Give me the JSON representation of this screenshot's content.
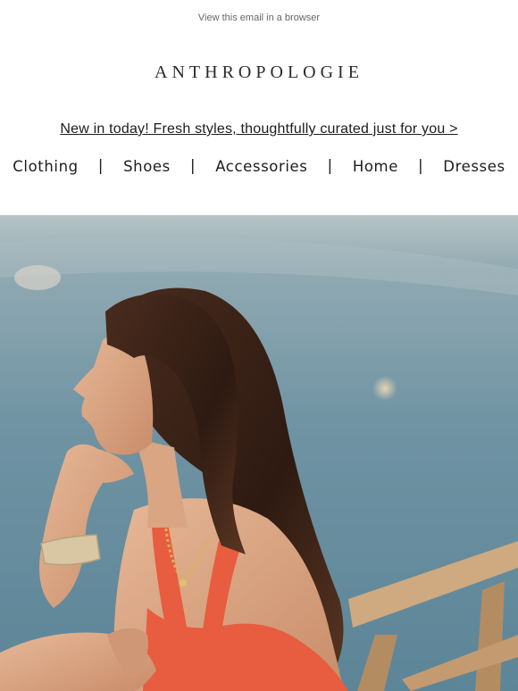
{
  "header": {
    "view_in_browser": "View this email in a browser",
    "brand": "ANTHROPOLOGIE",
    "promo": "New in today! Fresh styles, thoughtfully curated just for you >"
  },
  "nav": {
    "items": [
      {
        "label": "Clothing"
      },
      {
        "label": "Shoes"
      },
      {
        "label": "Accessories"
      },
      {
        "label": "Home"
      },
      {
        "label": "Dresses"
      }
    ],
    "separator": "|"
  },
  "colors": {
    "sea": "#6f93a3",
    "skin": "#d9a583",
    "hair": "#3a2218",
    "swimsuit": "#e85c3f",
    "rail": "#c8a27a"
  }
}
